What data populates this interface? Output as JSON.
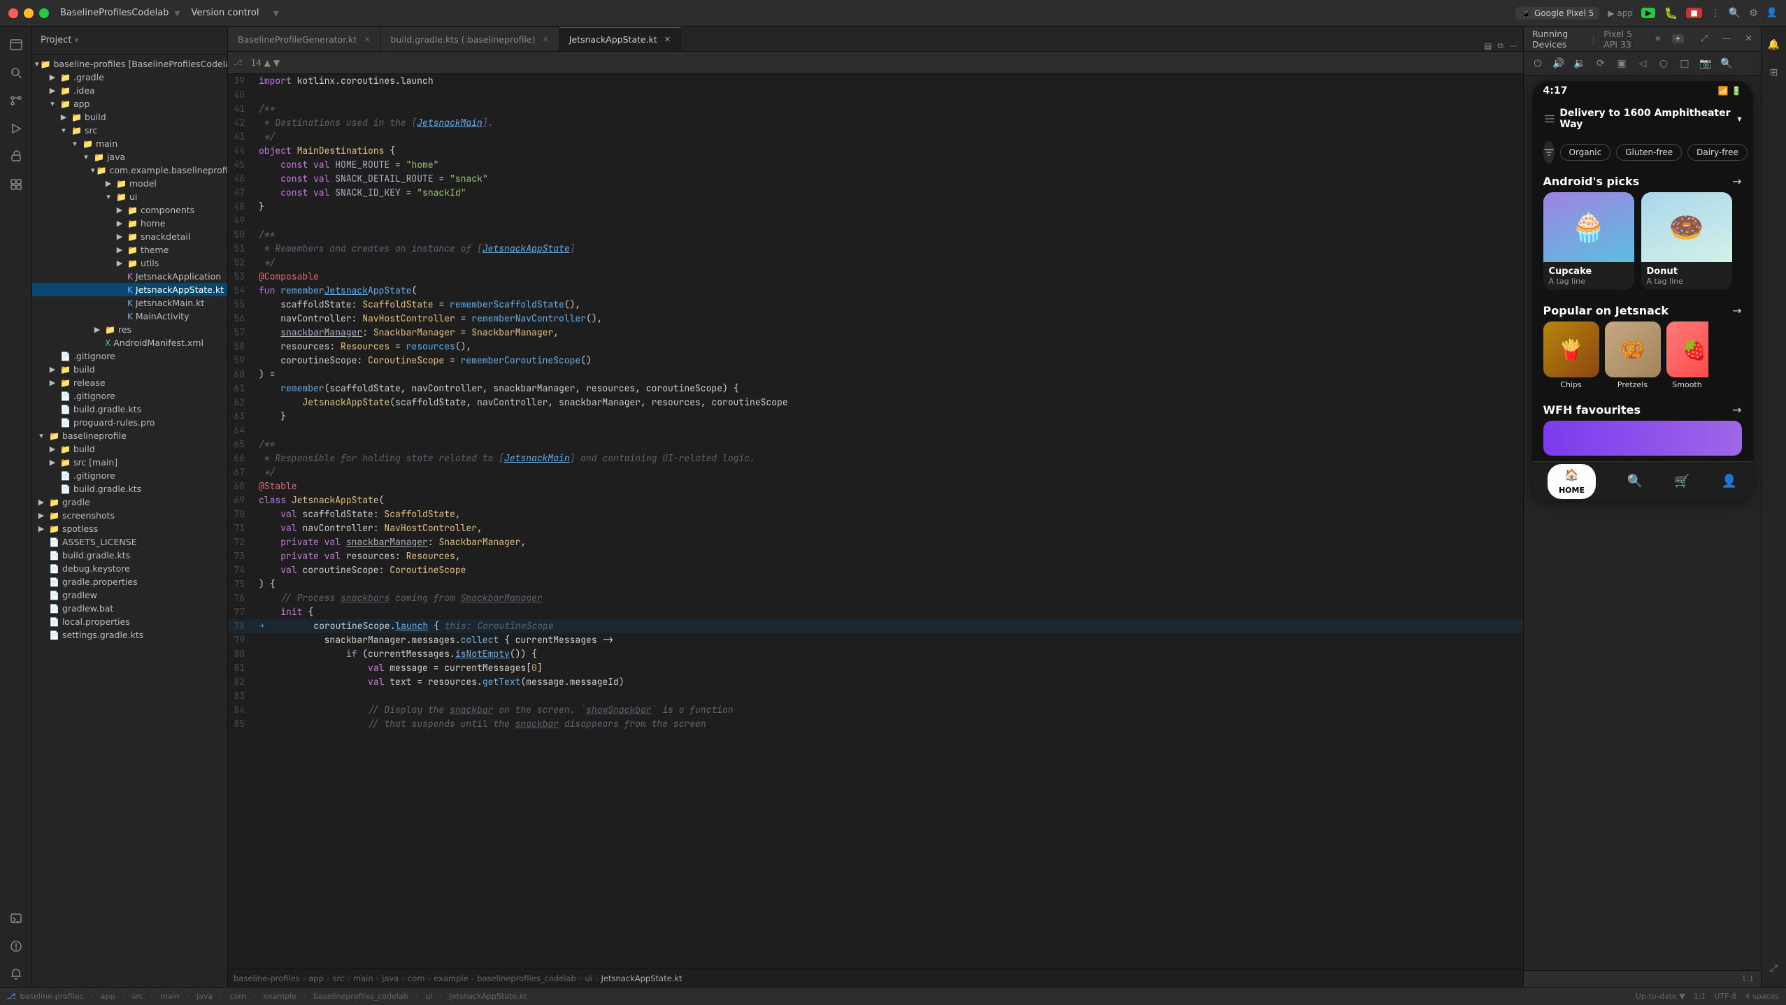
{
  "titlebar": {
    "project_name": "BaselineProfilesCodelab",
    "version_control": "Version control",
    "device": "Google Pixel 5",
    "app": "app",
    "run_label": "▶ app"
  },
  "tabs": [
    {
      "label": "BaselineProfileGenerator.kt",
      "active": false
    },
    {
      "label": "build.gradle.kts (:baselineprofile)",
      "active": false
    },
    {
      "label": "JetsnackAppState.kt",
      "active": true
    }
  ],
  "running_devices": {
    "label": "Running Devices",
    "device_label": "Pixel 5 API 33"
  },
  "file_tree": {
    "items": [
      {
        "name": "baseline-profiles [BaselineProfilesCodelab]",
        "depth": 0,
        "type": "root",
        "expanded": true
      },
      {
        "name": ".gradle",
        "depth": 1,
        "type": "folder",
        "expanded": false
      },
      {
        "name": ".idea",
        "depth": 1,
        "type": "folder",
        "expanded": false
      },
      {
        "name": "app",
        "depth": 1,
        "type": "folder",
        "expanded": true
      },
      {
        "name": "build",
        "depth": 2,
        "type": "folder",
        "expanded": false
      },
      {
        "name": "src",
        "depth": 2,
        "type": "folder",
        "expanded": true
      },
      {
        "name": "main",
        "depth": 3,
        "type": "folder",
        "expanded": true
      },
      {
        "name": "java",
        "depth": 4,
        "type": "folder",
        "expanded": true
      },
      {
        "name": "com.example.baselineprofiles_codel",
        "depth": 5,
        "type": "folder",
        "expanded": true
      },
      {
        "name": "model",
        "depth": 6,
        "type": "folder",
        "expanded": false
      },
      {
        "name": "ui",
        "depth": 6,
        "type": "folder",
        "expanded": true
      },
      {
        "name": "components",
        "depth": 7,
        "type": "folder",
        "expanded": false
      },
      {
        "name": "home",
        "depth": 7,
        "type": "folder",
        "expanded": false
      },
      {
        "name": "snackdetail",
        "depth": 7,
        "type": "folder",
        "expanded": false
      },
      {
        "name": "theme",
        "depth": 7,
        "type": "folder",
        "expanded": false
      },
      {
        "name": "utils",
        "depth": 7,
        "type": "folder",
        "expanded": false
      },
      {
        "name": "JetsnackApplication",
        "depth": 7,
        "type": "kt",
        "icon": "🟣"
      },
      {
        "name": "JetsnackAppState.kt",
        "depth": 7,
        "type": "kt-active",
        "icon": "🔵"
      },
      {
        "name": "JetsnackMain.kt",
        "depth": 7,
        "type": "kt",
        "icon": "🔵"
      },
      {
        "name": "MainActivity",
        "depth": 7,
        "type": "kt",
        "icon": "🔵"
      },
      {
        "name": "res",
        "depth": 4,
        "type": "folder",
        "expanded": false
      },
      {
        "name": "AndroidManifest.xml",
        "depth": 4,
        "type": "xml",
        "icon": "🟢"
      },
      {
        "name": ".gitignore",
        "depth": 1,
        "type": "file"
      },
      {
        "name": "build",
        "depth": 1,
        "type": "folder",
        "expanded": false
      },
      {
        "name": "release",
        "depth": 1,
        "type": "folder",
        "expanded": false
      },
      {
        "name": ".gitignore",
        "depth": 1,
        "type": "file"
      },
      {
        "name": "build.gradle.kts",
        "depth": 1,
        "type": "file"
      },
      {
        "name": "proguard-rules.pro",
        "depth": 1,
        "type": "file"
      },
      {
        "name": "baselineprofile",
        "depth": 0,
        "type": "folder",
        "expanded": true
      },
      {
        "name": "build",
        "depth": 1,
        "type": "folder",
        "expanded": false
      },
      {
        "name": "src [main]",
        "depth": 1,
        "type": "folder",
        "expanded": false
      },
      {
        "name": ".gitignore",
        "depth": 1,
        "type": "file"
      },
      {
        "name": "build.gradle.kts",
        "depth": 1,
        "type": "file"
      },
      {
        "name": "gradle",
        "depth": 0,
        "type": "folder",
        "expanded": false
      },
      {
        "name": "screenshots",
        "depth": 0,
        "type": "folder",
        "expanded": false
      },
      {
        "name": "spotless",
        "depth": 0,
        "type": "folder",
        "expanded": false
      },
      {
        "name": "ASSETS_LICENSE",
        "depth": 0,
        "type": "file"
      },
      {
        "name": "build.gradle.kts",
        "depth": 0,
        "type": "file"
      },
      {
        "name": "debug.keystore",
        "depth": 0,
        "type": "file"
      },
      {
        "name": "gradle.properties",
        "depth": 0,
        "type": "file"
      },
      {
        "name": "gradlew",
        "depth": 0,
        "type": "file"
      },
      {
        "name": "gradlew.bat",
        "depth": 0,
        "type": "file"
      },
      {
        "name": "local.properties",
        "depth": 0,
        "type": "file"
      },
      {
        "name": "settings.gradle.kts",
        "depth": 0,
        "type": "file"
      }
    ]
  },
  "code": {
    "lines": [
      {
        "num": 39,
        "content": "import kotlinx.coroutines.launch"
      },
      {
        "num": 40,
        "content": ""
      },
      {
        "num": 41,
        "content": "/**"
      },
      {
        "num": 42,
        "content": " * Destinations used in the [JetsnackMain]."
      },
      {
        "num": 43,
        "content": " */"
      },
      {
        "num": 44,
        "content": "object MainDestinations {"
      },
      {
        "num": 45,
        "content": "    const val HOME_ROUTE = \"home\""
      },
      {
        "num": 46,
        "content": "    const val SNACK_DETAIL_ROUTE = \"snack\""
      },
      {
        "num": 47,
        "content": "    const val SNACK_ID_KEY = \"snackId\""
      },
      {
        "num": 48,
        "content": "}"
      },
      {
        "num": 49,
        "content": ""
      },
      {
        "num": 50,
        "content": "/**"
      },
      {
        "num": 51,
        "content": " * Remembers and creates an instance of [JetsnackAppState]"
      },
      {
        "num": 52,
        "content": " */"
      },
      {
        "num": 53,
        "content": "@Composable"
      },
      {
        "num": 54,
        "content": "fun rememberJetsnackAppState("
      },
      {
        "num": 55,
        "content": "    scaffoldState: ScaffoldState = rememberScaffoldState(),"
      },
      {
        "num": 56,
        "content": "    navController: NavHostController = rememberNavController(),"
      },
      {
        "num": 57,
        "content": "    snackbarManager: SnackbarManager = SnackbarManager,"
      },
      {
        "num": 58,
        "content": "    resources: Resources = resources(),"
      },
      {
        "num": 59,
        "content": "    coroutineScope: CoroutineScope = rememberCoroutineScope()"
      },
      {
        "num": 60,
        "content": ") ="
      },
      {
        "num": 61,
        "content": "    remember(scaffoldState, navController, snackbarManager, resources, coroutineScope) {"
      },
      {
        "num": 62,
        "content": "        JetsnackAppState(scaffoldState, navController, snackbarManager, resources, coroutineScope"
      },
      {
        "num": 63,
        "content": "    }"
      },
      {
        "num": 64,
        "content": ""
      },
      {
        "num": 65,
        "content": "/**"
      },
      {
        "num": 66,
        "content": " * Responsible for holding state related to [JetsnackMain] and containing UI-related logic."
      },
      {
        "num": 67,
        "content": " */"
      },
      {
        "num": 68,
        "content": "@Stable"
      },
      {
        "num": 69,
        "content": "class JetsnackAppState("
      },
      {
        "num": 70,
        "content": "    val scaffoldState: ScaffoldState,"
      },
      {
        "num": 71,
        "content": "    val navController: NavHostController,"
      },
      {
        "num": 72,
        "content": "    private val snackbarManager: SnackbarManager,"
      },
      {
        "num": 73,
        "content": "    private val resources: Resources,"
      },
      {
        "num": 74,
        "content": "    val coroutineScope: CoroutineScope"
      },
      {
        "num": 75,
        "content": ") {"
      },
      {
        "num": 76,
        "content": "    // Process snackbars coming from SnackbarManager"
      },
      {
        "num": 77,
        "content": "    init {"
      },
      {
        "num": 78,
        "content": "        coroutineScope.launch { this: CoroutineScope"
      },
      {
        "num": 79,
        "content": "            snackbarManager.messages.collect { currentMessages ->"
      },
      {
        "num": 80,
        "content": "                if (currentMessages.isNotEmpty()) {"
      },
      {
        "num": 81,
        "content": "                    val message = currentMessages[0]"
      },
      {
        "num": 82,
        "content": "                    val text = resources.getText(message.messageId)"
      },
      {
        "num": 83,
        "content": ""
      },
      {
        "num": 84,
        "content": "                    // Display the snackbar on the screen. `showSnackbar` is a function"
      },
      {
        "num": 85,
        "content": "                    // that suspends until the snackbar disappears from the screen"
      }
    ]
  },
  "device": {
    "time": "4:17",
    "header": {
      "delivery_text": "Delivery to 1600 Amphitheater Way",
      "chevron": "▾"
    },
    "filters": [
      "Organic",
      "Gluten-free",
      "Dairy-free"
    ],
    "sections": {
      "androids_picks": {
        "title": "Android's picks",
        "arrow": "→",
        "cards": [
          {
            "name": "Cupcake",
            "tagline": "A tag line"
          },
          {
            "name": "Donut",
            "tagline": "A tag line"
          }
        ]
      },
      "popular": {
        "title": "Popular on Jetsnack",
        "arrow": "→",
        "items": [
          {
            "name": "Chips"
          },
          {
            "name": "Pretzels"
          },
          {
            "name": "Smooth"
          }
        ]
      },
      "wfh": {
        "title": "WFH favourites",
        "arrow": "→"
      }
    },
    "nav": {
      "items": [
        "HOME",
        "🔍",
        "🛒",
        "👤"
      ]
    }
  },
  "breadcrumb": {
    "parts": [
      "baseline-profiles",
      "app",
      "src",
      "main",
      "java",
      "com",
      "example",
      "baselineprofiles_codelab",
      "ui",
      "JetsnackAppState.kt"
    ]
  },
  "statusbar": {
    "left": "⎇ baseline-profiles",
    "right": "UTF-8   4 spaces",
    "line_col": "1:1"
  }
}
